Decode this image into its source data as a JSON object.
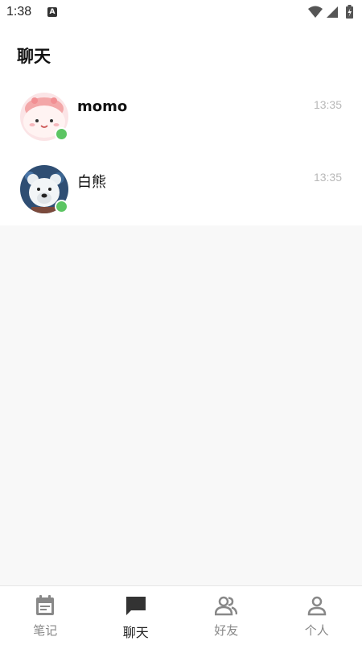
{
  "status_bar": {
    "time": "1:38",
    "notification_icon": "A"
  },
  "header": {
    "title": "聊天"
  },
  "chats": [
    {
      "name": "momo",
      "time": "13:35",
      "online": true,
      "avatar": "pink-cartoon-avatar"
    },
    {
      "name": "白熊",
      "time": "13:35",
      "online": true,
      "avatar": "polar-bear-avatar"
    }
  ],
  "bottom_nav": {
    "items": [
      {
        "label": "笔记",
        "icon": "calendar-note-icon",
        "active": false
      },
      {
        "label": "聊天",
        "icon": "chat-bubble-icon",
        "active": true
      },
      {
        "label": "好友",
        "icon": "friends-icon",
        "active": false
      },
      {
        "label": "个人",
        "icon": "person-icon",
        "active": false
      }
    ]
  },
  "colors": {
    "online": "#5cc563",
    "active_icon": "#333333",
    "inactive_icon": "#888888",
    "time_text": "#b8b8b8"
  }
}
